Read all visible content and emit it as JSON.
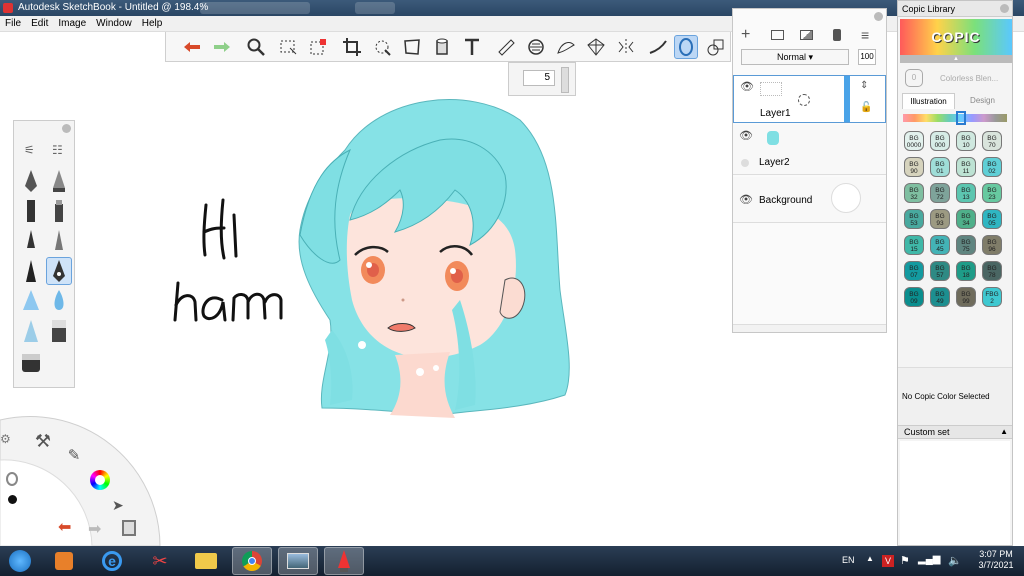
{
  "window": {
    "title": "Autodesk SketchBook - Untitled @ 198.4%"
  },
  "menu": [
    "File",
    "Edit",
    "Image",
    "Window",
    "Help"
  ],
  "brush_size": {
    "value": "5"
  },
  "canvas": {
    "handwriting": [
      "Hi",
      "ham"
    ]
  },
  "layers": {
    "blend_mode": "Normal",
    "opacity": "100",
    "items": [
      {
        "name": "Layer1",
        "selected": true
      },
      {
        "name": "Layer2",
        "selected": false
      },
      {
        "name": "Background",
        "selected": false
      }
    ]
  },
  "copic": {
    "title": "Copic Library",
    "logo": "COPIC",
    "colorless_blender": "Colorless Blen...",
    "colorless_code": "0",
    "tabs": [
      "Illustration",
      "Design"
    ],
    "swatches": [
      {
        "code": "BG\n0000",
        "color": "#e2f1ed"
      },
      {
        "code": "BG\n000",
        "color": "#d6ece6"
      },
      {
        "code": "BG\n10",
        "color": "#cfe8df"
      },
      {
        "code": "BG\n70",
        "color": "#d9e4dc"
      },
      {
        "code": "BG\n90",
        "color": "#d6d3bd"
      },
      {
        "code": "BG\n01",
        "color": "#9fded8"
      },
      {
        "code": "BG\n11",
        "color": "#bde2d3"
      },
      {
        "code": "BG\n02",
        "color": "#5fcfd6"
      },
      {
        "code": "BG\n32",
        "color": "#7fbfa1"
      },
      {
        "code": "BG\n72",
        "color": "#7ea39a"
      },
      {
        "code": "BG\n13",
        "color": "#5cc6b0"
      },
      {
        "code": "BG\n23",
        "color": "#67c9a0"
      },
      {
        "code": "BG\n53",
        "color": "#48a99f"
      },
      {
        "code": "BG\n93",
        "color": "#9c9a82"
      },
      {
        "code": "BG\n34",
        "color": "#4fb08a"
      },
      {
        "code": "BG\n05",
        "color": "#2fb6c2"
      },
      {
        "code": "BG\n15",
        "color": "#3fb8a8"
      },
      {
        "code": "BG\n45",
        "color": "#43b3b6"
      },
      {
        "code": "BG\n75",
        "color": "#5f8580"
      },
      {
        "code": "BG\n96",
        "color": "#807d69"
      },
      {
        "code": "BG\n07",
        "color": "#139aa0"
      },
      {
        "code": "BG\n57",
        "color": "#2e8a84"
      },
      {
        "code": "BG\n18",
        "color": "#1e9c88"
      },
      {
        "code": "BG\n78",
        "color": "#4a6663"
      },
      {
        "code": "BG\n09",
        "color": "#0a8e8e"
      },
      {
        "code": "BG\n49",
        "color": "#1d8f90"
      },
      {
        "code": "BG\n99",
        "color": "#6f6c5c"
      },
      {
        "code": "FBG\n2",
        "color": "#3ec8d0"
      }
    ],
    "no_selection": "No Copic Color Selected",
    "custom_set": "Custom set"
  },
  "tray": {
    "lang": "EN",
    "time": "3:07 PM",
    "date": "3/7/2021"
  }
}
